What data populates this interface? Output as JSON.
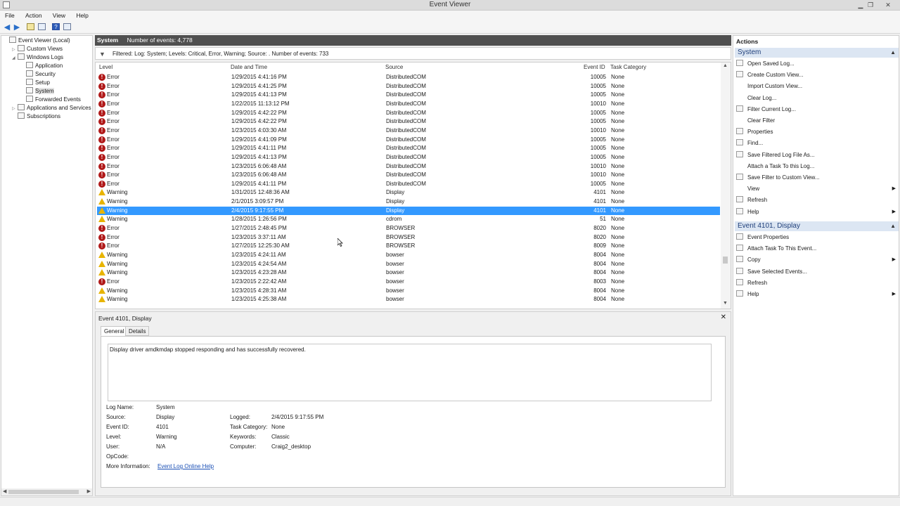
{
  "window": {
    "title": "Event Viewer"
  },
  "menu": [
    "File",
    "Action",
    "View",
    "Help"
  ],
  "tree": [
    {
      "label": "Event Viewer (Local)",
      "indent": 0,
      "tw": "",
      "sel": false
    },
    {
      "label": "Custom Views",
      "indent": 1,
      "tw": "▷",
      "sel": false
    },
    {
      "label": "Windows Logs",
      "indent": 1,
      "tw": "◢",
      "sel": false
    },
    {
      "label": "Application",
      "indent": 2,
      "tw": "",
      "sel": false
    },
    {
      "label": "Security",
      "indent": 2,
      "tw": "",
      "sel": false
    },
    {
      "label": "Setup",
      "indent": 2,
      "tw": "",
      "sel": false
    },
    {
      "label": "System",
      "indent": 2,
      "tw": "",
      "sel": true
    },
    {
      "label": "Forwarded Events",
      "indent": 2,
      "tw": "",
      "sel": false
    },
    {
      "label": "Applications and Services Lo",
      "indent": 1,
      "tw": "▷",
      "sel": false
    },
    {
      "label": "Subscriptions",
      "indent": 1,
      "tw": "",
      "sel": false
    }
  ],
  "center": {
    "header_title": "System",
    "header_count": "Number of events: 4,778",
    "filter_text": "Filtered: Log: System; Levels: Critical, Error, Warning; Source: . Number of events: 733"
  },
  "columns": [
    "Level",
    "Date and Time",
    "Source",
    "Event ID",
    "Task Category"
  ],
  "events": [
    {
      "level": "Error",
      "datetime": "1/29/2015 4:41:16 PM",
      "source": "DistributedCOM",
      "id": "10005",
      "task": "None"
    },
    {
      "level": "Error",
      "datetime": "1/29/2015 4:41:25 PM",
      "source": "DistributedCOM",
      "id": "10005",
      "task": "None"
    },
    {
      "level": "Error",
      "datetime": "1/29/2015 4:41:13 PM",
      "source": "DistributedCOM",
      "id": "10005",
      "task": "None"
    },
    {
      "level": "Error",
      "datetime": "1/22/2015 11:13:12 PM",
      "source": "DistributedCOM",
      "id": "10010",
      "task": "None"
    },
    {
      "level": "Error",
      "datetime": "1/29/2015 4:42:22 PM",
      "source": "DistributedCOM",
      "id": "10005",
      "task": "None"
    },
    {
      "level": "Error",
      "datetime": "1/29/2015 4:42:22 PM",
      "source": "DistributedCOM",
      "id": "10005",
      "task": "None"
    },
    {
      "level": "Error",
      "datetime": "1/23/2015 4:03:30 AM",
      "source": "DistributedCOM",
      "id": "10010",
      "task": "None"
    },
    {
      "level": "Error",
      "datetime": "1/29/2015 4:41:09 PM",
      "source": "DistributedCOM",
      "id": "10005",
      "task": "None"
    },
    {
      "level": "Error",
      "datetime": "1/29/2015 4:41:11 PM",
      "source": "DistributedCOM",
      "id": "10005",
      "task": "None"
    },
    {
      "level": "Error",
      "datetime": "1/29/2015 4:41:13 PM",
      "source": "DistributedCOM",
      "id": "10005",
      "task": "None"
    },
    {
      "level": "Error",
      "datetime": "1/23/2015 6:06:48 AM",
      "source": "DistributedCOM",
      "id": "10010",
      "task": "None"
    },
    {
      "level": "Error",
      "datetime": "1/23/2015 6:06:48 AM",
      "source": "DistributedCOM",
      "id": "10010",
      "task": "None"
    },
    {
      "level": "Error",
      "datetime": "1/29/2015 4:41:11 PM",
      "source": "DistributedCOM",
      "id": "10005",
      "task": "None"
    },
    {
      "level": "Warning",
      "datetime": "1/31/2015 12:48:36 AM",
      "source": "Display",
      "id": "4101",
      "task": "None"
    },
    {
      "level": "Warning",
      "datetime": "2/1/2015 3:09:57 PM",
      "source": "Display",
      "id": "4101",
      "task": "None"
    },
    {
      "level": "Warning",
      "datetime": "2/4/2015 9:17:55 PM",
      "source": "Display",
      "id": "4101",
      "task": "None",
      "selected": true
    },
    {
      "level": "Warning",
      "datetime": "1/28/2015 1:26:56 PM",
      "source": "cdrom",
      "id": "51",
      "task": "None"
    },
    {
      "level": "Error",
      "datetime": "1/27/2015 2:48:45 PM",
      "source": "BROWSER",
      "id": "8020",
      "task": "None"
    },
    {
      "level": "Error",
      "datetime": "1/23/2015 3:37:11 AM",
      "source": "BROWSER",
      "id": "8020",
      "task": "None"
    },
    {
      "level": "Error",
      "datetime": "1/27/2015 12:25:30 AM",
      "source": "BROWSER",
      "id": "8009",
      "task": "None"
    },
    {
      "level": "Warning",
      "datetime": "1/23/2015 4:24:11 AM",
      "source": "bowser",
      "id": "8004",
      "task": "None"
    },
    {
      "level": "Warning",
      "datetime": "1/23/2015 4:24:54 AM",
      "source": "bowser",
      "id": "8004",
      "task": "None"
    },
    {
      "level": "Warning",
      "datetime": "1/23/2015 4:23:28 AM",
      "source": "bowser",
      "id": "8004",
      "task": "None"
    },
    {
      "level": "Error",
      "datetime": "1/23/2015 2:22:42 AM",
      "source": "bowser",
      "id": "8003",
      "task": "None"
    },
    {
      "level": "Warning",
      "datetime": "1/23/2015 4:28:31 AM",
      "source": "bowser",
      "id": "8004",
      "task": "None"
    },
    {
      "level": "Warning",
      "datetime": "1/23/2015 4:25:38 AM",
      "source": "bowser",
      "id": "8004",
      "task": "None"
    }
  ],
  "detail": {
    "title": "Event 4101, Display",
    "tabs": [
      "General",
      "Details"
    ],
    "message": "Display driver amdkmdap stopped responding and has successfully recovered.",
    "log_name_label": "Log Name:",
    "log_name": "System",
    "source_label": "Source:",
    "source": "Display",
    "event_id_label": "Event ID:",
    "event_id": "4101",
    "level_label": "Level:",
    "level": "Warning",
    "user_label": "User:",
    "user": "N/A",
    "opcode_label": "OpCode:",
    "opcode": "",
    "more_info_label": "More Information:",
    "more_info_link": "Event Log Online Help",
    "logged_label": "Logged:",
    "logged": "2/4/2015 9:17:55 PM",
    "task_cat_label": "Task Category:",
    "task_cat": "None",
    "keywords_label": "Keywords:",
    "keywords": "Classic",
    "computer_label": "Computer:",
    "computer": "Craig2_desktop"
  },
  "actions": {
    "header": "Actions",
    "section1": "System",
    "section1_items": [
      {
        "label": "Open Saved Log...",
        "icon": true,
        "sub": false
      },
      {
        "label": "Create Custom View...",
        "icon": true,
        "sub": false
      },
      {
        "label": "Import Custom View...",
        "icon": false,
        "sub": false
      },
      {
        "label": "Clear Log...",
        "icon": false,
        "sub": false
      },
      {
        "label": "Filter Current Log...",
        "icon": true,
        "sub": false
      },
      {
        "label": "Clear Filter",
        "icon": false,
        "sub": false
      },
      {
        "label": "Properties",
        "icon": true,
        "sub": false
      },
      {
        "label": "Find...",
        "icon": true,
        "sub": false
      },
      {
        "label": "Save Filtered Log File As...",
        "icon": true,
        "sub": false
      },
      {
        "label": "Attach a Task To this Log...",
        "icon": false,
        "sub": false
      },
      {
        "label": "Save Filter to Custom View...",
        "icon": true,
        "sub": false
      },
      {
        "label": "View",
        "icon": false,
        "sub": true
      },
      {
        "label": "Refresh",
        "icon": true,
        "sub": false
      },
      {
        "label": "Help",
        "icon": true,
        "sub": true
      }
    ],
    "section2": "Event 4101, Display",
    "section2_items": [
      {
        "label": "Event Properties",
        "icon": true,
        "sub": false
      },
      {
        "label": "Attach Task To This Event...",
        "icon": true,
        "sub": false
      },
      {
        "label": "Copy",
        "icon": true,
        "sub": true
      },
      {
        "label": "Save Selected Events...",
        "icon": true,
        "sub": false
      },
      {
        "label": "Refresh",
        "icon": true,
        "sub": false
      },
      {
        "label": "Help",
        "icon": true,
        "sub": true
      }
    ]
  },
  "colors": {
    "selection": "#3399ff",
    "error": "#b01818",
    "warning": "#e8b400",
    "header": "#505050",
    "section": "#dce6f3"
  }
}
